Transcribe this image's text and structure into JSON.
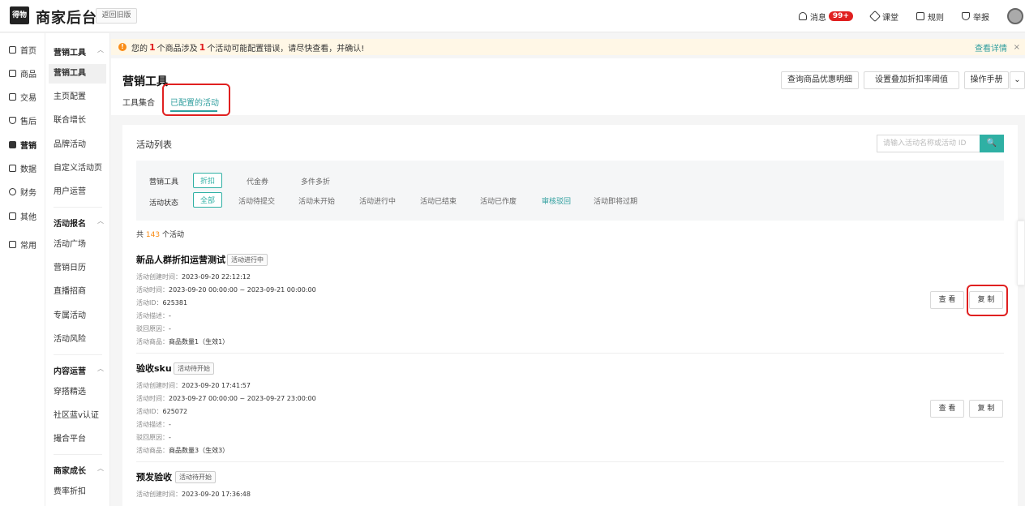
{
  "header": {
    "logo_text": "得物",
    "brand": "商家后台",
    "old_version": "返回旧版",
    "messages": "消息",
    "messages_badge": "99+",
    "classroom": "课堂",
    "rules": "规则",
    "report": "举报"
  },
  "sidebar": {
    "primary": [
      {
        "label": "首页",
        "icon": "home-icon"
      },
      {
        "label": "商品",
        "icon": "product-icon"
      },
      {
        "label": "交易",
        "icon": "trade-icon"
      },
      {
        "label": "售后",
        "icon": "aftersale-icon"
      },
      {
        "label": "营销",
        "icon": "marketing-icon"
      },
      {
        "label": "数据",
        "icon": "data-icon"
      },
      {
        "label": "财务",
        "icon": "finance-icon"
      },
      {
        "label": "其他",
        "icon": "other-icon"
      },
      {
        "label": "常用",
        "icon": "common-icon"
      }
    ],
    "groups": [
      {
        "title": "营销工具",
        "items": [
          "营销工具",
          "主页配置",
          "联合增长",
          "品牌活动",
          "自定义活动页",
          "用户运营"
        ]
      },
      {
        "title": "活动报名",
        "items": [
          "活动广场",
          "营销日历",
          "直播招商",
          "专属活动",
          "活动风险"
        ]
      },
      {
        "title": "内容运营",
        "items": [
          "穿搭精选",
          "社区蓝v认证",
          "撮合平台"
        ]
      },
      {
        "title": "商家成长",
        "items": [
          "费率折扣"
        ]
      }
    ]
  },
  "alert": {
    "prefix": "您的",
    "count1": "1",
    "mid": "个商品涉及",
    "count2": "1",
    "suffix": "个活动可能配置错误，请尽快查看，并确认!",
    "detail_link": "查看详情",
    "close": "×"
  },
  "page": {
    "title": "营销工具",
    "tab_all": "工具集合",
    "tab_configured": "已配置的活动",
    "btn_query": "查询商品优惠明细",
    "btn_threshold": "设置叠加折扣率阈值",
    "btn_manual": "操作手册",
    "btn_more": "⌄"
  },
  "list": {
    "title": "活动列表",
    "search_placeholder": "请输入活动名称或活动 ID",
    "search_btn": "🔍",
    "filter_tool_label": "营销工具",
    "tool_options": [
      "折扣",
      "代金券",
      "多件多折"
    ],
    "filter_status_label": "活动状态",
    "status_options": [
      "全部",
      "活动待提交",
      "活动未开始",
      "活动进行中",
      "活动已结束",
      "活动已作废",
      "审核驳回",
      "活动即将过期"
    ],
    "total_prefix": "共",
    "total_count": "143",
    "total_suffix": "个活动",
    "labels": {
      "created": "活动创建时间：",
      "time": "活动时间：",
      "id": "活动ID：",
      "desc": "活动描述：",
      "reject": "驳回原因：",
      "products": "活动商品："
    },
    "view_btn": "查 看",
    "copy_btn": "复 制",
    "activities": [
      {
        "name": "新品人群折扣运营测试",
        "status": "活动进行中",
        "created": "2023-09-20 22:12:12",
        "time": "2023-09-20 00:00:00 ~ 2023-09-21 00:00:00",
        "id": "625381",
        "desc": "-",
        "reject": "-",
        "products": "商品数量1（生效1）"
      },
      {
        "name": "验收sku",
        "status": "活动待开始",
        "created": "2023-09-20 17:41:57",
        "time": "2023-09-27 00:00:00 ~ 2023-09-27 23:00:00",
        "id": "625072",
        "desc": "-",
        "reject": "-",
        "products": "商品数量3（生效3）"
      },
      {
        "name": "预发验收",
        "status": "活动待开始",
        "created": "2023-09-20 17:36:48"
      }
    ]
  },
  "colors": {
    "accent": "#2fb0a4",
    "highlight": "#e02020",
    "warning": "#fa8c16"
  }
}
